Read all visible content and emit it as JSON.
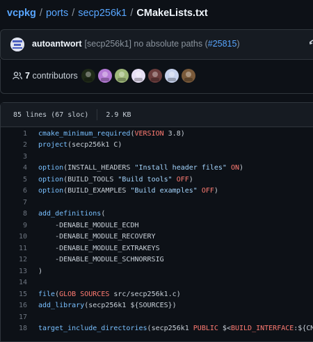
{
  "breadcrumb": {
    "repo": "vcpkg",
    "sep": "/",
    "folder1": "ports",
    "folder2": "secp256k1",
    "file": "CMakeLists.txt"
  },
  "commit": {
    "author": "autoantwort",
    "message": "[secp256k1] no absolute paths (",
    "pr": "#25815",
    "close": ")",
    "history_icon": "history-icon"
  },
  "contributors": {
    "count": "7",
    "label": "contributors",
    "avatar_colors": [
      "#1f2a18",
      "#b67bd6",
      "#9fb87a",
      "#e8e0f5",
      "#6b3d3d",
      "#c8d3ee",
      "#7a5a3a"
    ]
  },
  "file_info": {
    "lines": "85 lines (67 sloc)",
    "size": "2.9 KB"
  },
  "code": {
    "lines": [
      {
        "n": "1",
        "tokens": [
          {
            "t": "cmake_minimum_required",
            "c": "fn"
          },
          {
            "t": "(",
            "c": ""
          },
          {
            "t": "VERSION",
            "c": "kw"
          },
          {
            "t": " 3.8)",
            "c": ""
          }
        ]
      },
      {
        "n": "2",
        "tokens": [
          {
            "t": "project",
            "c": "fn"
          },
          {
            "t": "(secp256k1 C)",
            "c": ""
          }
        ]
      },
      {
        "n": "3",
        "tokens": []
      },
      {
        "n": "4",
        "tokens": [
          {
            "t": "option",
            "c": "fn"
          },
          {
            "t": "(INSTALL_HEADERS ",
            "c": ""
          },
          {
            "t": "\"Install header files\"",
            "c": "str"
          },
          {
            "t": " ",
            "c": ""
          },
          {
            "t": "ON",
            "c": "kw"
          },
          {
            "t": ")",
            "c": ""
          }
        ]
      },
      {
        "n": "5",
        "tokens": [
          {
            "t": "option",
            "c": "fn"
          },
          {
            "t": "(BUILD_TOOLS ",
            "c": ""
          },
          {
            "t": "\"Build tools\"",
            "c": "str"
          },
          {
            "t": " ",
            "c": ""
          },
          {
            "t": "OFF",
            "c": "kw"
          },
          {
            "t": ")",
            "c": ""
          }
        ]
      },
      {
        "n": "6",
        "tokens": [
          {
            "t": "option",
            "c": "fn"
          },
          {
            "t": "(BUILD_EXAMPLES ",
            "c": ""
          },
          {
            "t": "\"Build examples\"",
            "c": "str"
          },
          {
            "t": " ",
            "c": ""
          },
          {
            "t": "OFF",
            "c": "kw"
          },
          {
            "t": ")",
            "c": ""
          }
        ]
      },
      {
        "n": "7",
        "tokens": []
      },
      {
        "n": "8",
        "tokens": [
          {
            "t": "add_definitions",
            "c": "fn"
          },
          {
            "t": "(",
            "c": ""
          }
        ]
      },
      {
        "n": "9",
        "tokens": [
          {
            "t": "    -DENABLE_MODULE_ECDH",
            "c": ""
          }
        ]
      },
      {
        "n": "10",
        "tokens": [
          {
            "t": "    -DENABLE_MODULE_RECOVERY",
            "c": ""
          }
        ]
      },
      {
        "n": "11",
        "tokens": [
          {
            "t": "    -DENABLE_MODULE_EXTRAKEYS",
            "c": ""
          }
        ]
      },
      {
        "n": "12",
        "tokens": [
          {
            "t": "    -DENABLE_MODULE_SCHNORRSIG",
            "c": ""
          }
        ]
      },
      {
        "n": "13",
        "tokens": [
          {
            "t": ")",
            "c": ""
          }
        ]
      },
      {
        "n": "14",
        "tokens": []
      },
      {
        "n": "15",
        "tokens": [
          {
            "t": "file",
            "c": "fn"
          },
          {
            "t": "(",
            "c": ""
          },
          {
            "t": "GLOB SOURCES",
            "c": "kw"
          },
          {
            "t": " src/secp256k1.c)",
            "c": ""
          }
        ]
      },
      {
        "n": "16",
        "tokens": [
          {
            "t": "add_library",
            "c": "fn"
          },
          {
            "t": "(secp256k1 ${SOURCES})",
            "c": ""
          }
        ]
      },
      {
        "n": "17",
        "tokens": []
      },
      {
        "n": "18",
        "tokens": [
          {
            "t": "target_include_directories",
            "c": "fn"
          },
          {
            "t": "(secp256k1 ",
            "c": ""
          },
          {
            "t": "PUBLIC",
            "c": "kw"
          },
          {
            "t": " $<",
            "c": ""
          },
          {
            "t": "BUILD_INTERFACE",
            "c": "kw"
          },
          {
            "t": ":${CMAKE",
            "c": ""
          }
        ]
      }
    ]
  }
}
